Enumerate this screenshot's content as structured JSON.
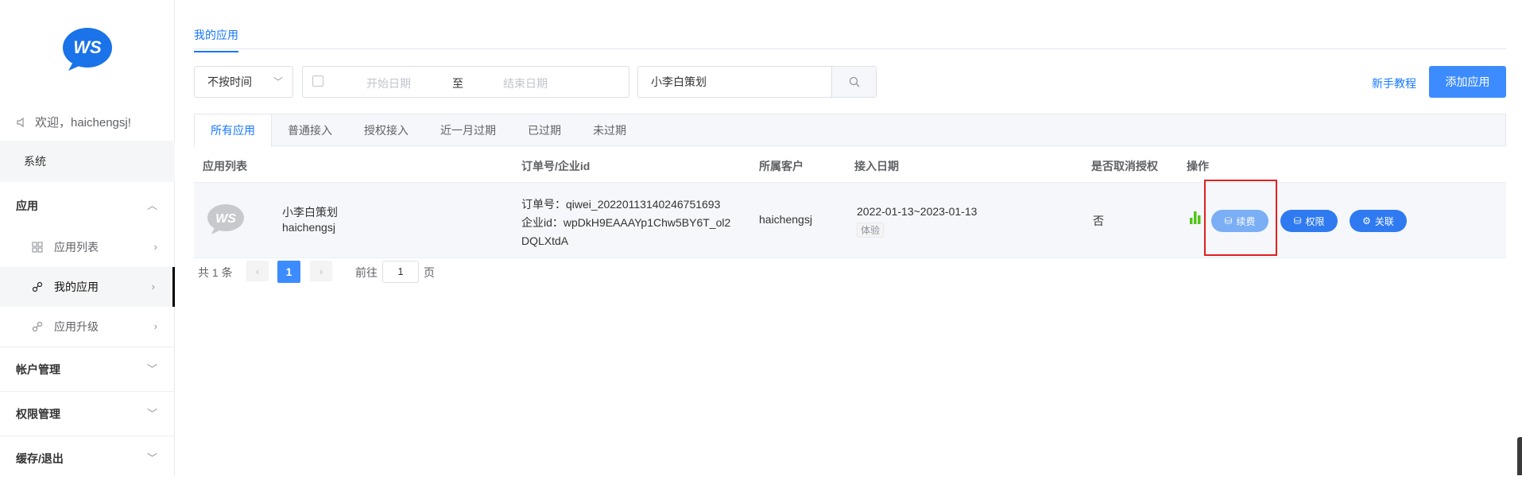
{
  "sidebar": {
    "logo_text": "WS",
    "welcome": "欢迎，haichengsj!",
    "system": "系统",
    "groups": [
      {
        "label": "应用",
        "items": [
          {
            "label": "应用列表"
          },
          {
            "label": "我的应用"
          },
          {
            "label": "应用升级"
          }
        ]
      },
      {
        "label": "帐户管理"
      },
      {
        "label": "权限管理"
      },
      {
        "label": "缓存/退出"
      }
    ]
  },
  "main": {
    "top_tab": "我的应用",
    "filters": {
      "time_select": "不按时间",
      "start_placeholder": "开始日期",
      "range_sep": "至",
      "end_placeholder": "结束日期",
      "search_value": "小李白策划"
    },
    "tutorial_link": "新手教程",
    "add_button": "添加应用",
    "tabs": [
      "所有应用",
      "普通接入",
      "授权接入",
      "近一月过期",
      "已过期",
      "未过期"
    ],
    "columns": [
      "应用列表",
      "订单号/企业id",
      "所属客户",
      "接入日期",
      "是否取消授权",
      "操作"
    ],
    "rows": [
      {
        "app_name": "小李白策划",
        "app_owner": "haichengsj",
        "order_line": "订单号：qiwei_20220113140246751693",
        "corp_line1": "企业id：wpDkH9EAAAYp1Chw5BY6T_ol2",
        "corp_line2": "DQLXtdA",
        "customer": "haichengsj",
        "date_range": "2022-01-13~2023-01-13",
        "tag": "体验",
        "cancelled": "否",
        "actions": {
          "renew": "续费",
          "permission": "权限",
          "link": "关联"
        }
      }
    ],
    "pagination": {
      "total": "共 1 条",
      "current": "1",
      "goto": "前往",
      "goto_value": "1",
      "page_suffix": "页"
    }
  },
  "colors": {
    "accent": "#3c8cff",
    "highlight": "#e02020",
    "renew_button": "#7aaef5"
  }
}
